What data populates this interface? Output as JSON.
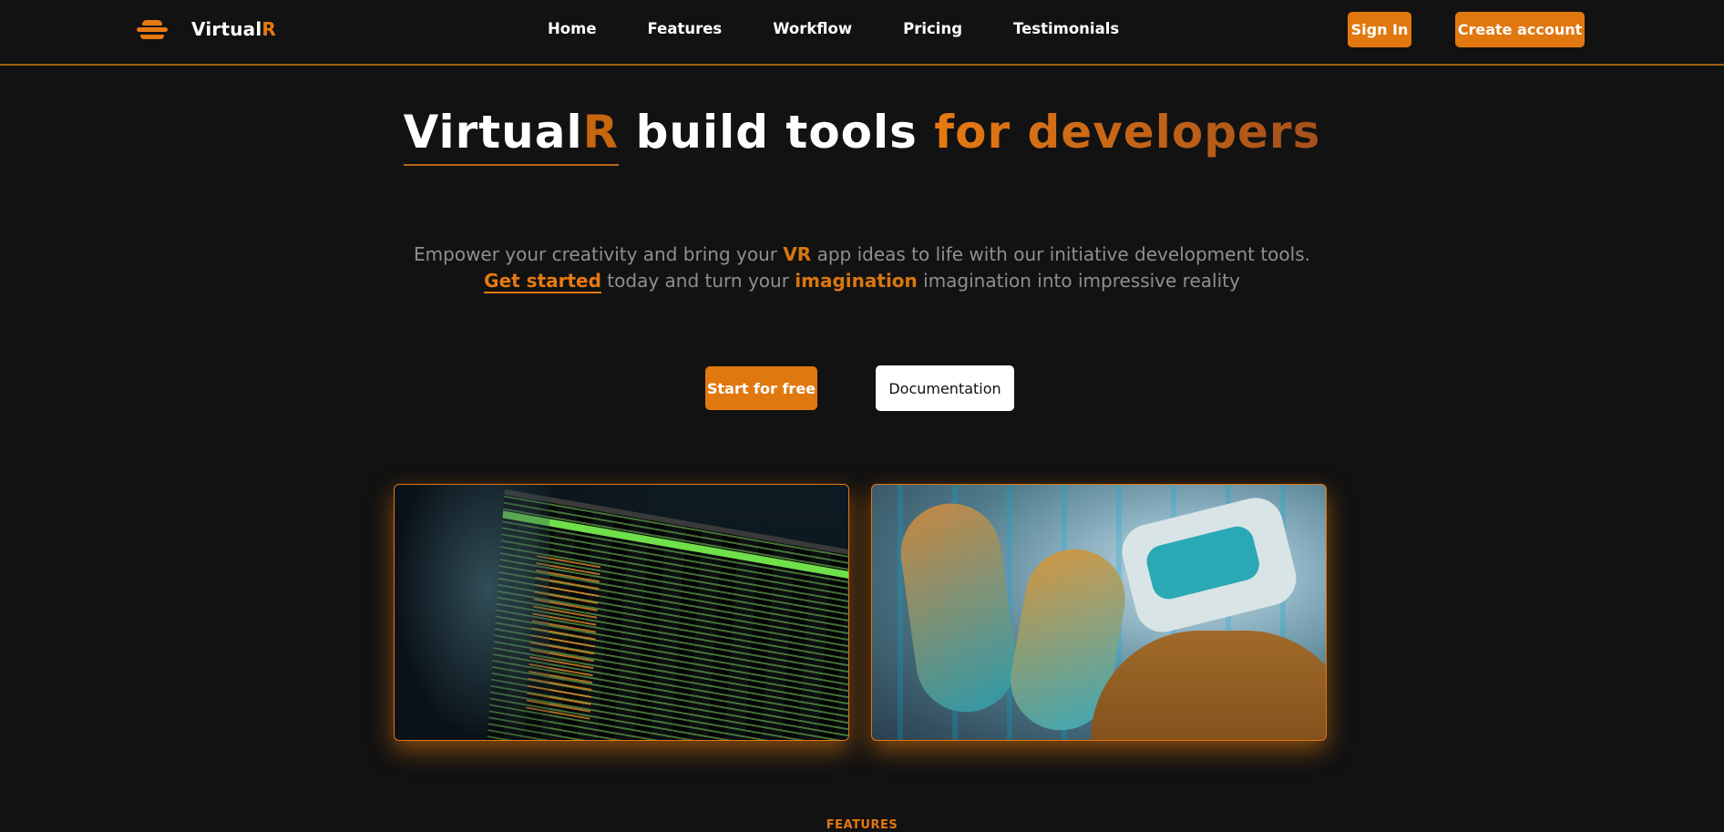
{
  "navbar": {
    "logo_text_main": "Virtual",
    "logo_text_accent": "R",
    "links": [
      "Home",
      "Features",
      "Workflow",
      "Pricing",
      "Testimonials"
    ],
    "sign_in": "Sign In",
    "create_account": "Create account"
  },
  "hero": {
    "title_brand_main": "Virtual",
    "title_brand_accent": "R",
    "title_middle": " build tools ",
    "title_accent": "for developers",
    "sub_line1_a": "Empower your creativity and bring your ",
    "sub_line1_hl": "VR",
    "sub_line1_b": " app ideas to life with our initiative development tools.",
    "sub_line2_link": "Get started",
    "sub_line2_a": " today and turn your ",
    "sub_line2_hl": "imagination",
    "sub_line2_b": " imagination into impressive reality",
    "start_button": "Start for free",
    "docs_button": "Documentation"
  },
  "section": {
    "label": "FEATURES"
  },
  "colors": {
    "accent": "#e1780f",
    "background": "#121212",
    "muted_text": "#8f8f8f"
  }
}
